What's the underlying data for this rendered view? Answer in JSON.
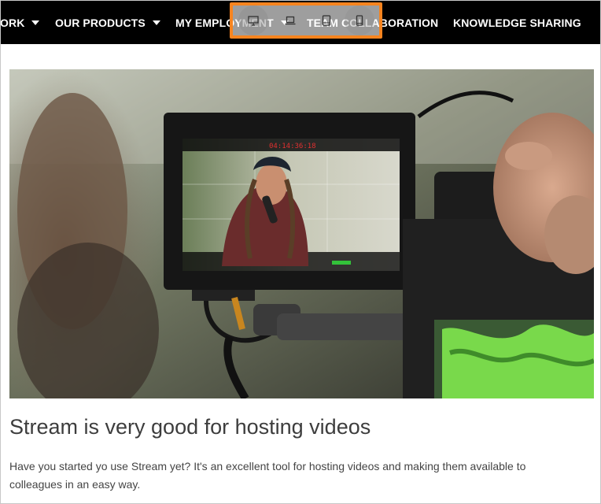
{
  "nav": {
    "items": [
      {
        "label": "ORK",
        "has_dropdown": true
      },
      {
        "label": "OUR PRODUCTS",
        "has_dropdown": true
      },
      {
        "label": "MY EMPLOYMENT",
        "has_dropdown": true
      },
      {
        "label": "TEAM COLLABORATION",
        "has_dropdown": false
      },
      {
        "label": "KNOWLEDGE SHARING",
        "has_dropdown": false
      }
    ]
  },
  "device_toolbar": {
    "buttons": [
      {
        "icon": "desktop-icon",
        "active": true
      },
      {
        "icon": "laptop-icon",
        "active": false
      },
      {
        "icon": "tablet-icon",
        "active": false
      },
      {
        "icon": "mobile-icon",
        "active": false
      }
    ],
    "highlight_color": "#f7841f"
  },
  "hero": {
    "monitor_timecode": "04:14:36:18"
  },
  "article": {
    "title": "Stream is very good for hosting videos",
    "body": "Have you started yo use Stream yet? It's an excellent tool for hosting videos and making them available to colleagues in an easy way."
  }
}
